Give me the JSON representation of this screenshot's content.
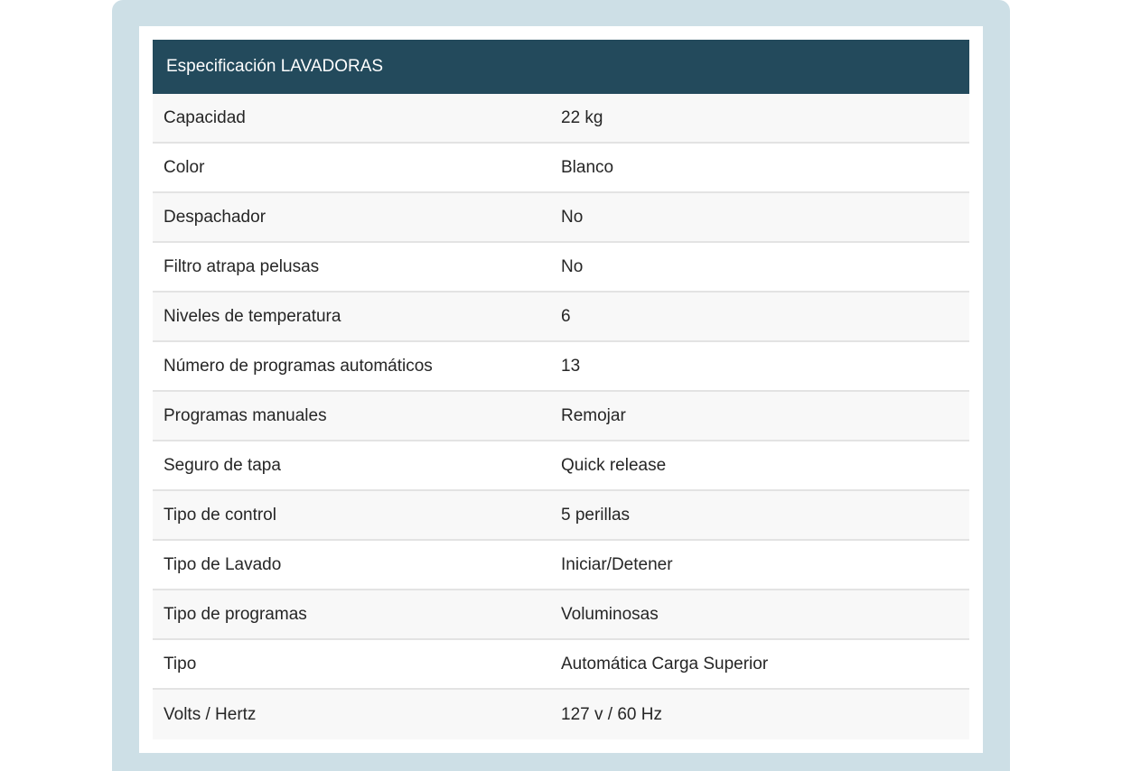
{
  "table": {
    "title": "Especificación LAVADORAS",
    "rows": [
      {
        "label": "Capacidad",
        "value": "22 kg"
      },
      {
        "label": "Color",
        "value": "Blanco"
      },
      {
        "label": "Despachador",
        "value": "No"
      },
      {
        "label": "Filtro atrapa pelusas",
        "value": "No"
      },
      {
        "label": "Niveles de temperatura",
        "value": "6"
      },
      {
        "label": "Número de programas automáticos",
        "value": "13"
      },
      {
        "label": "Programas manuales",
        "value": "Remojar"
      },
      {
        "label": "Seguro de tapa",
        "value": "Quick release"
      },
      {
        "label": "Tipo de control",
        "value": "5 perillas"
      },
      {
        "label": "Tipo de Lavado",
        "value": "Iniciar/Detener"
      },
      {
        "label": "Tipo de programas",
        "value": "Voluminosas"
      },
      {
        "label": "Tipo",
        "value": "Automática Carga Superior"
      },
      {
        "label": "Volts / Hertz",
        "value": "127 v / 60 Hz"
      }
    ]
  },
  "colors": {
    "frame": "#cddfe6",
    "header": "#234a5c",
    "row_alt": "#f8f8f8",
    "divider": "#e3e3e3"
  }
}
